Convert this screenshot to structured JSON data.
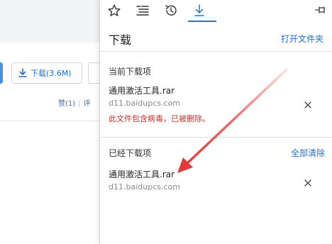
{
  "background_page": {
    "download_button_label": "下载(3.6M)",
    "like_label": "赞(1)",
    "comment_label": "评"
  },
  "panel": {
    "tabs": [
      {
        "icon": "star-icon"
      },
      {
        "icon": "reading-list-icon"
      },
      {
        "icon": "history-icon"
      },
      {
        "icon": "download-icon",
        "active": true
      }
    ],
    "title": "下载",
    "open_folder": "打开文件夹",
    "current_section": "当前下载项",
    "finished_section": "已经下载项",
    "clear_all": "全部清除",
    "current_items": [
      {
        "filename": "通用激活工具.rar",
        "host": "d11.baidupcs.com",
        "warning": "此文件包含病毒，已被删除。"
      }
    ],
    "finished_items": [
      {
        "filename": "通用激活工具.rar",
        "host": "d11.baidupcs.com"
      }
    ]
  },
  "colors": {
    "accent": "#1f6fd1",
    "warning": "#c6332d",
    "annotation_arrow": "#e23a3a"
  }
}
